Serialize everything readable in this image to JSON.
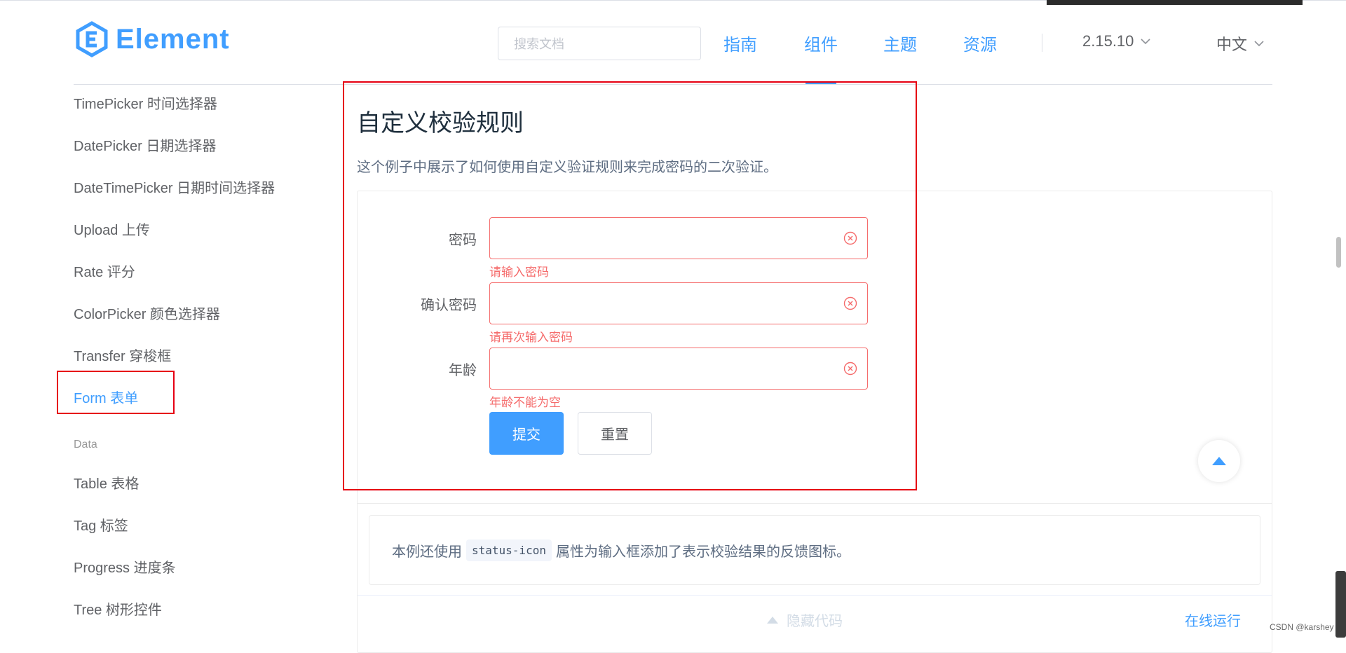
{
  "header": {
    "logo_text": "Element",
    "search_placeholder": "搜索文档",
    "nav": [
      "指南",
      "组件",
      "主题",
      "资源"
    ],
    "version": "2.15.10",
    "language": "中文"
  },
  "sidebar": {
    "items": [
      "TimePicker 时间选择器",
      "DatePicker 日期选择器",
      "DateTimePicker 日期时间选择器",
      "Upload 上传",
      "Rate 评分",
      "ColorPicker 颜色选择器",
      "Transfer 穿梭框",
      "Form 表单"
    ],
    "group_label": "Data",
    "data_items": [
      "Table 表格",
      "Tag 标签",
      "Progress 进度条",
      "Tree 树形控件"
    ]
  },
  "main": {
    "title": "自定义校验规则",
    "description": "这个例子中展示了如何使用自定义验证规则来完成密码的二次验证。",
    "form": {
      "fields": [
        {
          "label": "密码",
          "error": "请输入密码"
        },
        {
          "label": "确认密码",
          "error": "请再次输入密码"
        },
        {
          "label": "年龄",
          "error": "年龄不能为空"
        }
      ],
      "submit": "提交",
      "reset": "重置"
    },
    "tip_prefix": "本例还使用",
    "tip_code": "status-icon",
    "tip_suffix": "属性为输入框添加了表示校验结果的反馈图标。",
    "hide_code": "隐藏代码",
    "run_online": "在线运行"
  },
  "watermark": "CSDN @karshey",
  "colors": {
    "brand": "#409eff",
    "error": "#f56c6c",
    "highlight_box": "#e60012"
  }
}
